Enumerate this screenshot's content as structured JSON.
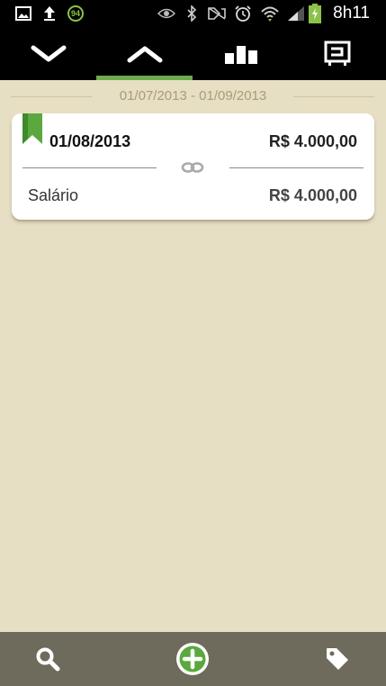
{
  "status_bar": {
    "time": "8h11",
    "notification_badge": "94",
    "icons": [
      "image-icon",
      "upload-icon",
      "notification-badge",
      "eye-icon",
      "bluetooth-icon",
      "mute-icon",
      "alarm-icon",
      "wifi-icon",
      "signal-icon",
      "battery-icon"
    ]
  },
  "tabs": [
    {
      "name": "collapse-tab",
      "icon": "chevron-down-icon",
      "active": false
    },
    {
      "name": "expand-tab",
      "icon": "chevron-up-icon",
      "active": true
    },
    {
      "name": "chart-tab",
      "icon": "bar-chart-icon",
      "active": false
    },
    {
      "name": "account-tab",
      "icon": "account-icon",
      "active": false
    }
  ],
  "period": {
    "range_label": "01/07/2013 - 01/09/2013"
  },
  "transactions": [
    {
      "date": "01/08/2013",
      "total": "R$ 4.000,00",
      "items": [
        {
          "label": "Salário",
          "value": "R$ 4.000,00"
        }
      ]
    }
  ],
  "bottom_bar": {
    "icons": [
      "search-icon",
      "add-icon",
      "tag-icon"
    ]
  },
  "colors": {
    "background": "#e7dfc4",
    "accent_green": "#6ea94e",
    "bottom_bar": "#6e6a5c",
    "top_bar": "#000000"
  }
}
